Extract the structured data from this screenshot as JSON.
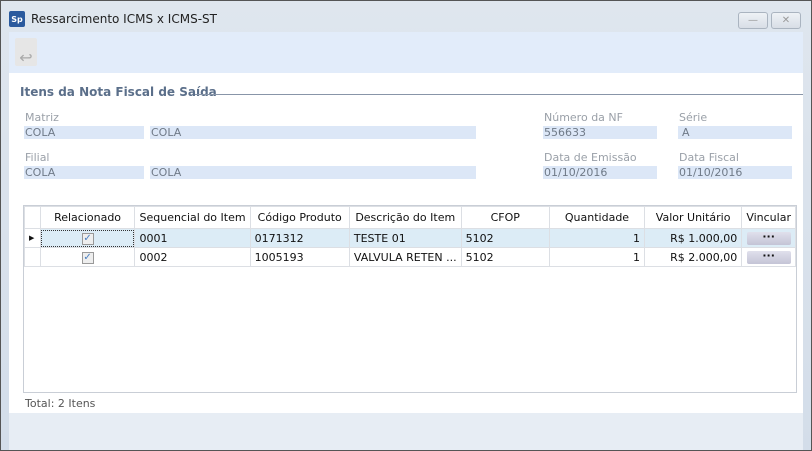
{
  "window": {
    "title": "Ressarcimento ICMS x ICMS-ST",
    "logo": "Sp",
    "minimize": "—",
    "close": "✕"
  },
  "toolbar": {
    "back_icon": "↩"
  },
  "section": {
    "title": "Itens da Nota Fiscal de Saída"
  },
  "fields": {
    "matriz": {
      "label": "Matriz",
      "code": "COLA",
      "name": "COLA"
    },
    "filial": {
      "label": "Filial",
      "code": "COLA",
      "name": "COLA"
    },
    "numero_nf": {
      "label": "Número da NF",
      "value": "556633"
    },
    "serie": {
      "label": "Série",
      "value": "A"
    },
    "data_emissao": {
      "label": "Data de Emissão",
      "value": "01/10/2016"
    },
    "data_fiscal": {
      "label": "Data Fiscal",
      "value": "01/10/2016"
    }
  },
  "grid": {
    "columns": [
      "Relacionado",
      "Sequencial do Item",
      "Código Produto",
      "Descrição do Item",
      "CFOP",
      "Quantidade",
      "Valor Unitário",
      "Vincular"
    ],
    "rows": [
      {
        "checked": "✓",
        "seq": "0001",
        "codigo": "0171312",
        "descricao": "TESTE 01",
        "cfop": "5102",
        "quantidade": "1",
        "valor": "R$ 1.000,00",
        "vincular": "···"
      },
      {
        "checked": "✓",
        "seq": "0002",
        "codigo": "1005193",
        "descricao": "VALVULA RETEN ...",
        "cfop": "5102",
        "quantidade": "1",
        "valor": "R$ 2.000,00",
        "vincular": "···"
      }
    ],
    "total": "Total: 2 Itens"
  }
}
